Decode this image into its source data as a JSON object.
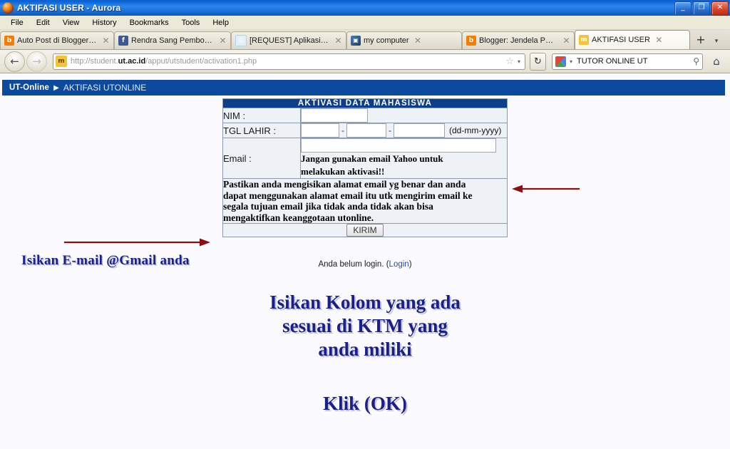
{
  "window": {
    "title_main": "AKTIFASI USER",
    "title_sep": " - ",
    "title_app": "Aurora",
    "minimize": "_",
    "maximize": "❐",
    "close": "✕"
  },
  "menubar": {
    "items": [
      {
        "label": "File"
      },
      {
        "label": "Edit"
      },
      {
        "label": "View"
      },
      {
        "label": "History"
      },
      {
        "label": "Bookmarks"
      },
      {
        "label": "Tools"
      },
      {
        "label": "Help"
      }
    ]
  },
  "tabs": {
    "items": [
      {
        "label": "Auto Post di Blogger/Bl...",
        "icon": "blogger-icon",
        "icon_glyph": "b",
        "active": false
      },
      {
        "label": "Rendra Sang Pembolang",
        "icon": "facebook-icon",
        "icon_glyph": "f",
        "active": false
      },
      {
        "label": "[REQUEST] Aplikasi Pe...",
        "icon": "forum-icon",
        "icon_glyph": "☰",
        "active": false
      },
      {
        "label": "my computer",
        "icon": "computer-icon",
        "icon_glyph": "▣",
        "active": false
      },
      {
        "label": "Blogger: Jendela Pecin...",
        "icon": "blogger-icon",
        "icon_glyph": "b",
        "active": false
      },
      {
        "label": "AKTIFASI USER",
        "icon": "ut-icon",
        "icon_glyph": "m",
        "active": true
      }
    ],
    "close_glyph": "✕",
    "new_tab_glyph": "+",
    "tab_list_glyph": "▾"
  },
  "navbar": {
    "back_glyph": "←",
    "forward_glyph": "→",
    "reload_glyph": "↻",
    "home_glyph": "⌂",
    "star_glyph": "☆",
    "caret_glyph": "▾",
    "magnifier_glyph": "⚲",
    "favicon": "ut-favicon",
    "url_scheme": "http://student.",
    "url_domain": "ut.ac.id",
    "url_path": "/apput/utstudent/activation1.php",
    "url_full": "http://student.ut.ac.id/apput/utstudent/activation1.php",
    "search_value": "TUTOR ONLINE UT",
    "search_engine": "google-icon"
  },
  "page": {
    "header": {
      "brand": "UT-Online",
      "separator": "▶",
      "breadcrumb": "AKTIFASI UTONLINE"
    },
    "form": {
      "title": "AKTIVASI DATA MAHASISWA",
      "nim_label": "NIM :",
      "nim_value": "",
      "tgl_label": "TGL LAHIR :",
      "tgl_dd": "",
      "tgl_mm": "",
      "tgl_yyyy": "",
      "tgl_dash1": "-",
      "tgl_dash2": "-",
      "tgl_hint": "(dd-mm-yyyy)",
      "email_label": "Email :",
      "email_value": "",
      "email_warning_l1": "Jangan gunakan email Yahoo untuk",
      "email_warning_l2": "melakukan aktivasi!!",
      "notice_l1": "Pastikan anda mengisikan alamat email yg benar dan anda",
      "notice_l2": "dapat menggunakan alamat email itu utk mengirim email ke",
      "notice_l3": "segala tujuan email jika tidak anda tidak akan bisa",
      "notice_l4": "mengaktifkan keanggotaan utonline.",
      "submit_label": "KIRIM"
    },
    "login_status": "Anda belum login. (",
    "login_link": "Login",
    "login_status_end": ")"
  },
  "annotations": {
    "gmail_text": "Isikan E-mail @Gmail anda",
    "block_l1": "Isikan Kolom yang ada",
    "block_l2": "sesuai di KTM yang",
    "block_l3": "anda miliki",
    "klik_text": "Klik (OK)",
    "arrow_color": "#8b0f0f",
    "text_color": "#1b1f8a"
  },
  "colors": {
    "titlebar_blue": "#0c62d6",
    "ut_bar_blue": "#0b4a9c",
    "table_header_blue": "#0b3f8c",
    "page_bg": "#fbfbff",
    "chrome_bg": "#ece9d8"
  }
}
